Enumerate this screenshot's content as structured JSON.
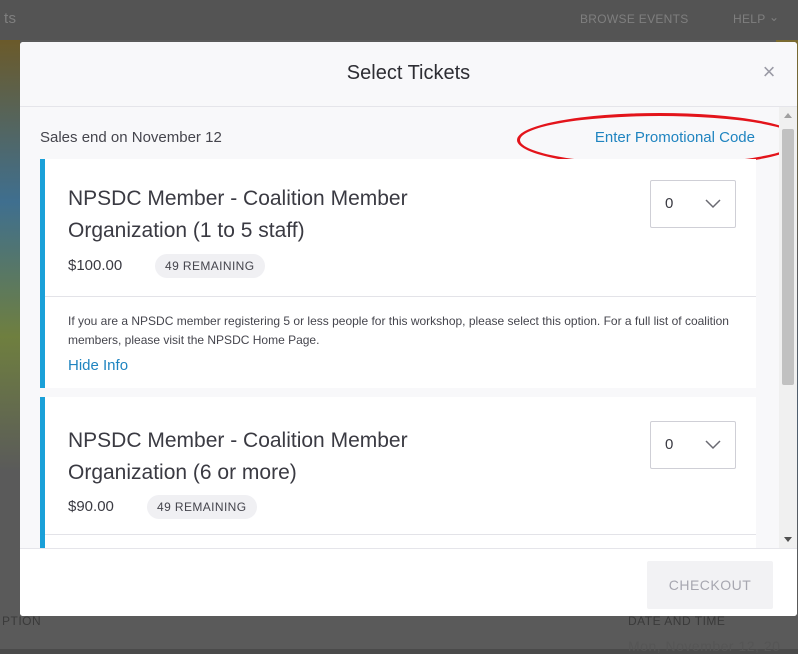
{
  "background": {
    "nav_left": "ts",
    "nav_browse": "BROWSE EVENTS",
    "nav_help": "HELP",
    "footer_left": "PTION",
    "footer_right": "DATE AND TIME",
    "footer_right_sub": "Mon, November 12, 20"
  },
  "modal": {
    "title": "Select Tickets",
    "close_icon": "close-icon",
    "sales_end": "Sales end on November 12",
    "promo_link": "Enter Promotional Code",
    "tickets": [
      {
        "name": "NPSDC Member - Coalition Member Organization (1 to 5 staff)",
        "price": "$100.00",
        "remaining": "49 REMAINING",
        "quantity": "0",
        "info": "If you are a NPSDC member registering 5 or less people for this workshop, please select this option. For a full list of coalition members, please visit the NPSDC Home Page.",
        "hide_info": "Hide Info"
      },
      {
        "name": "NPSDC Member - Coalition Member Organization (6 or more)",
        "price": "$90.00",
        "remaining": "49 REMAINING",
        "quantity": "0"
      }
    ],
    "checkout": "CHECKOUT"
  },
  "colors": {
    "accent": "#1aa0d8",
    "link": "#1f84c0",
    "annotation": "#e3141b"
  }
}
